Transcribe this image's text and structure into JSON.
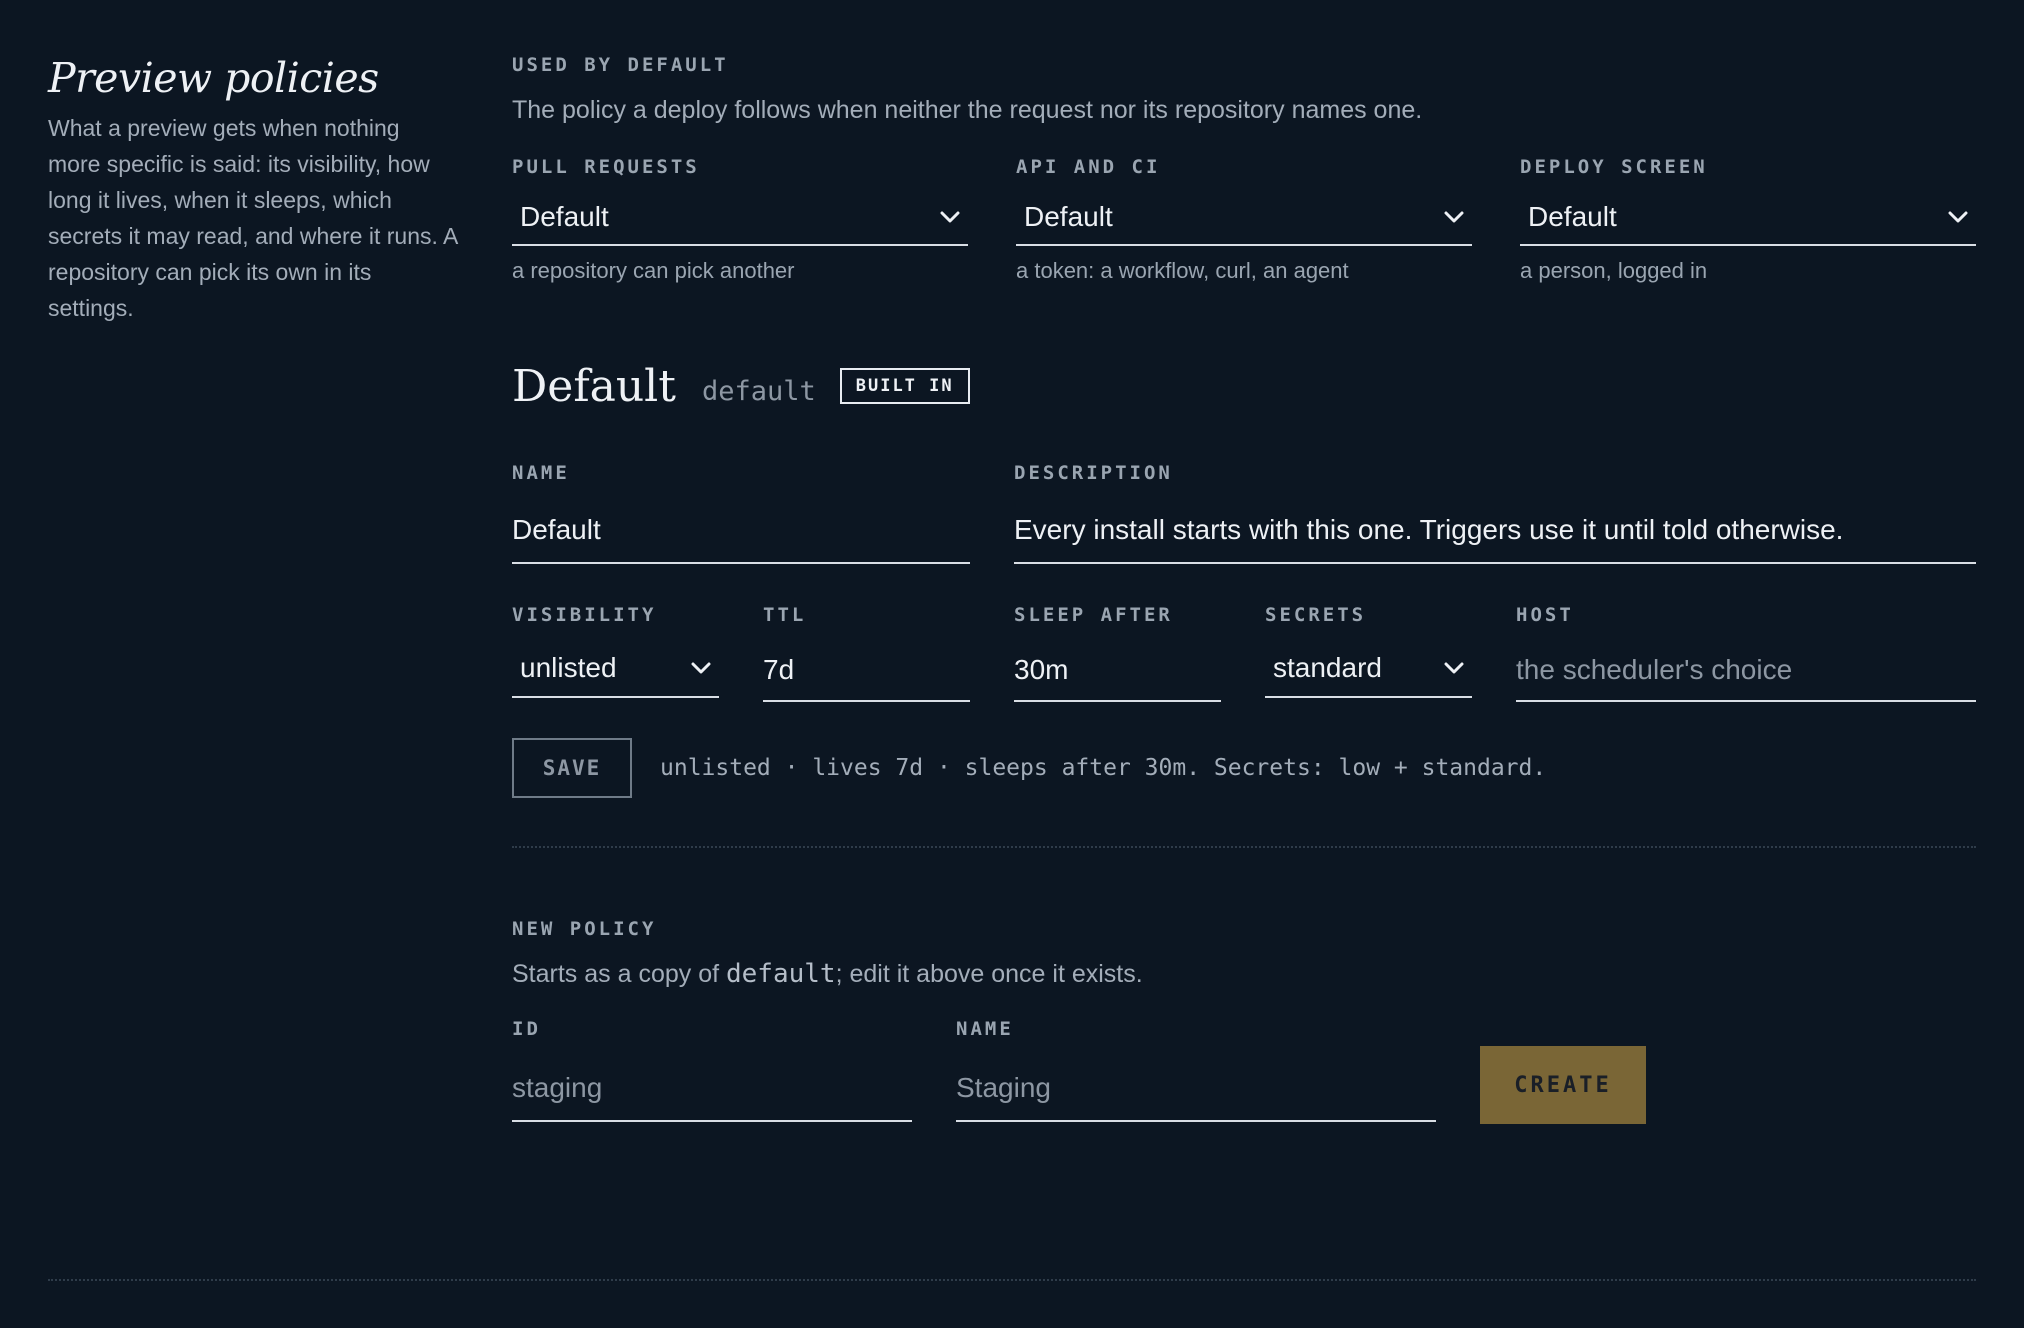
{
  "sidebar": {
    "title": "Preview policies",
    "description": "What a preview gets when nothing more specific is said: its visibility, how long it lives, when it sleeps, which secrets it may read, and where it runs. A repository can pick its own in its settings."
  },
  "defaults": {
    "heading": "USED BY DEFAULT",
    "help": "The policy a deploy follows when neither the request nor its repository names one.",
    "pull_requests": {
      "label": "PULL REQUESTS",
      "value": "Default",
      "hint": "a repository can pick another"
    },
    "api_ci": {
      "label": "API AND CI",
      "value": "Default",
      "hint": "a token: a workflow, curl, an agent"
    },
    "deploy_screen": {
      "label": "DEPLOY SCREEN",
      "value": "Default",
      "hint": "a person, logged in"
    }
  },
  "policy": {
    "name": "Default",
    "id": "default",
    "badge": "BUILT IN",
    "name_label": "NAME",
    "name_value": "Default",
    "description_label": "DESCRIPTION",
    "description_value": "Every install starts with this one. Triggers use it until told otherwise.",
    "visibility_label": "VISIBILITY",
    "visibility_value": "unlisted",
    "ttl_label": "TTL",
    "ttl_value": "7d",
    "sleep_label": "SLEEP AFTER",
    "sleep_value": "30m",
    "secrets_label": "SECRETS",
    "secrets_value": "standard",
    "host_label": "HOST",
    "host_placeholder": "the scheduler's choice",
    "save_label": "SAVE",
    "summary": "unlisted · lives 7d · sleeps after 30m. Secrets: low + standard."
  },
  "new_policy": {
    "heading": "NEW POLICY",
    "help_before": "Starts as a copy of ",
    "help_code": "default",
    "help_after": "; edit it above once it exists.",
    "id_label": "ID",
    "id_placeholder": "staging",
    "name_label": "NAME",
    "name_placeholder": "Staging",
    "create_label": "CREATE"
  },
  "colors": {
    "background": "#0c1622",
    "accent": "#7a6636",
    "text": "#eef1f5",
    "muted": "#9aa5b1"
  },
  "icons": {
    "dropdown": "chevron-down-icon"
  }
}
